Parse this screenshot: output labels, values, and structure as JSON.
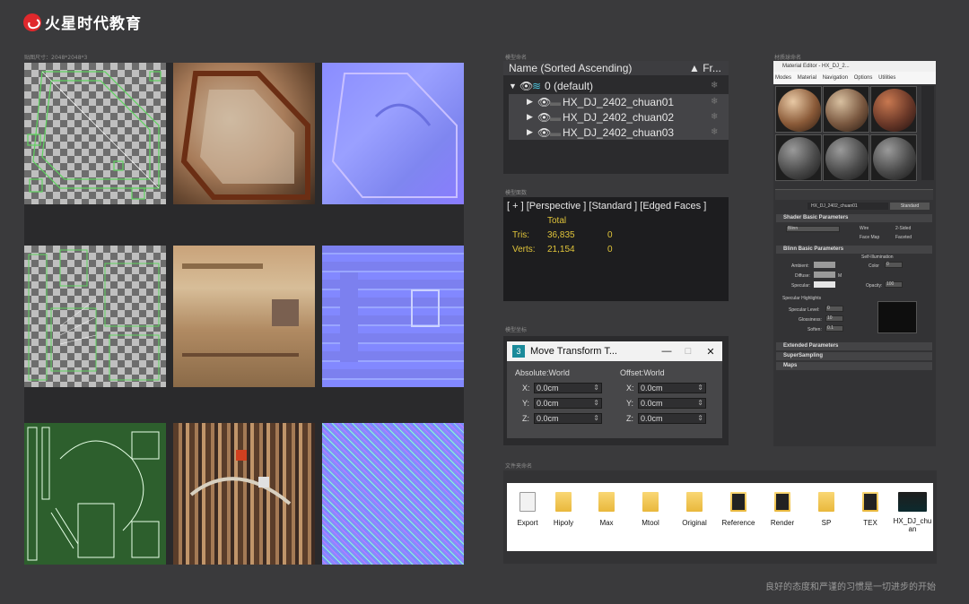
{
  "brand": {
    "name": "火星时代教育"
  },
  "labels": {
    "texture_size": "贴图尺寸：2048*2048*3",
    "scene": "模型命名",
    "stats": "模型面数",
    "transform": "模型坐标",
    "material": "材质球命名",
    "files": "文件夹命名"
  },
  "scene_explorer": {
    "header": "Name (Sorted Ascending)",
    "header_freeze": "▲ Fr...",
    "root": "0 (default)",
    "items": [
      "HX_DJ_2402_chuan01",
      "HX_DJ_2402_chuan02",
      "HX_DJ_2402_chuan03"
    ]
  },
  "viewport_stats": {
    "header": "[ + ] [Perspective ] [Standard ] [Edged Faces ]",
    "col_total": "Total",
    "tris_label": "Tris:",
    "tris_total": "36,835",
    "tris_sel": "0",
    "verts_label": "Verts:",
    "verts_total": "21,154",
    "verts_sel": "0"
  },
  "move_transform": {
    "title": "Move Transform T...",
    "min": "—",
    "max": "□",
    "close": "✕",
    "absolute": "Absolute:World",
    "offset": "Offset:World",
    "x_label": "X:",
    "y_label": "Y:",
    "z_label": "Z:",
    "abs_x": "0.0cm",
    "abs_y": "0.0cm",
    "abs_z": "0.0cm",
    "off_x": "0.0cm",
    "off_y": "0.0cm",
    "off_z": "0.0cm"
  },
  "material_editor": {
    "title": "Material Editor - HX_DJ_2...",
    "menu": [
      "Modes",
      "Material",
      "Navigation",
      "Options",
      "Utilities"
    ],
    "mat_name": "HX_DJ_2402_chuan01",
    "mat_type": "Standard",
    "rollouts": [
      "Shader Basic Parameters",
      "Blinn Basic Parameters",
      "Extended Parameters",
      "SuperSampling",
      "Maps"
    ],
    "shader": "Blinn",
    "wire": "Wire",
    "two_sided": "2-Sided",
    "face_map": "Face Map",
    "faceted": "Faceted",
    "ambient": "Ambient:",
    "diffuse": "Diffuse:",
    "specular": "Specular:",
    "self_illum": "Self-Illumination",
    "color": "Color",
    "color_val": "0",
    "opacity": "Opacity:",
    "opacity_val": "100",
    "spec_highlights": "Specular Highlights",
    "spec_level": "Specular Level:",
    "spec_level_val": "0",
    "glossiness": "Glossiness:",
    "gloss_val": "10",
    "soften": "Soften:",
    "soften_val": "0.1",
    "m": "M"
  },
  "folders": [
    "Export",
    "Hipoly",
    "Max",
    "Mtool",
    "Original",
    "Reference",
    "Render",
    "SP",
    "TEX",
    "HX_DJ_chuan"
  ],
  "slogan": "良好的态度和严谨的习惯是一切进步的开始"
}
